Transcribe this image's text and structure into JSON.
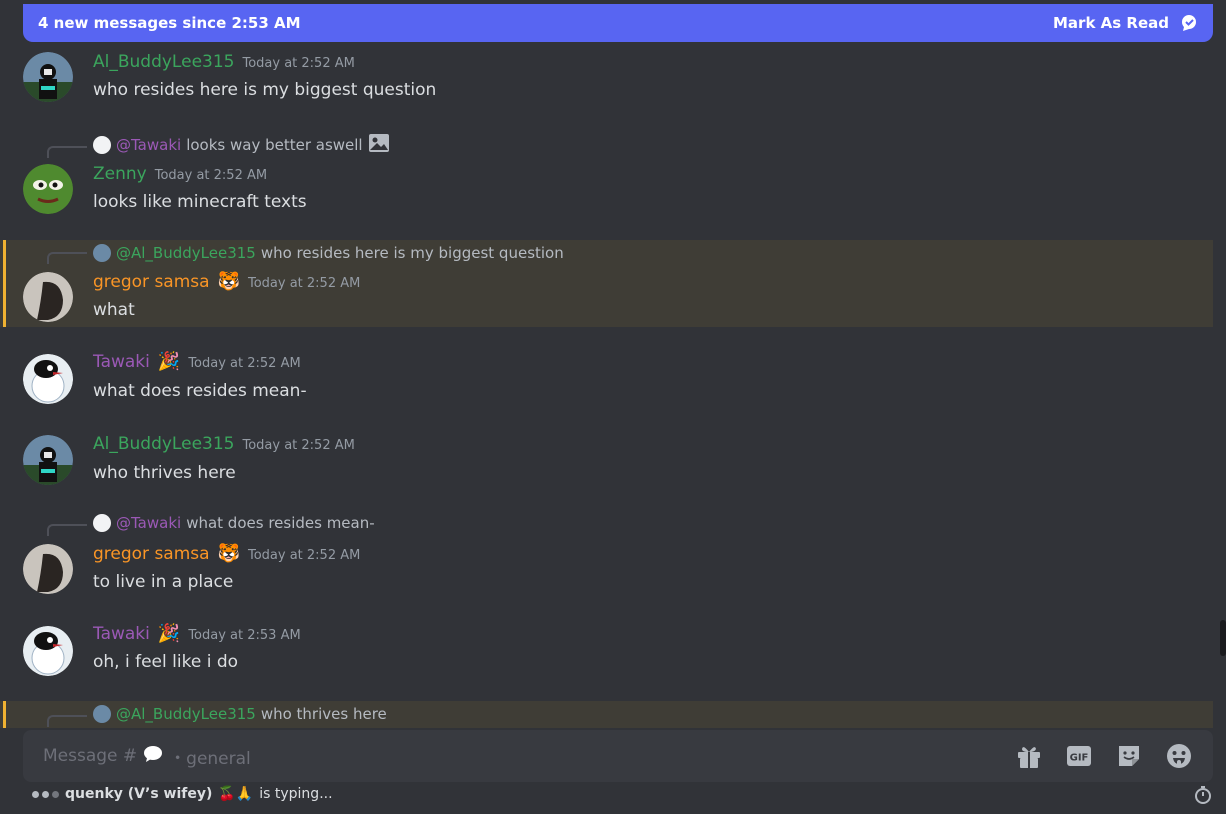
{
  "new_messages_bar": {
    "text": "4 new messages since 2:53 AM",
    "mark_as_read": "Mark As Read"
  },
  "messages": [
    {
      "author": "Al_BuddyLee315",
      "time": "Today at 2:52 AM",
      "text": "who resides here is my biggest question"
    },
    {
      "reply_to": "@Tawaki",
      "reply_text": "looks way better aswell",
      "author": "Zenny",
      "time": "Today at 2:52 AM",
      "text": "looks like minecraft texts"
    },
    {
      "reply_to": "@Al_BuddyLee315",
      "reply_text": "who resides here is my biggest question",
      "author": "gregor samsa",
      "time": "Today at 2:52 AM",
      "text": "what"
    },
    {
      "author": "Tawaki",
      "time": "Today at 2:52 AM",
      "text": "what does resides mean-"
    },
    {
      "author": "Al_BuddyLee315",
      "time": "Today at 2:52 AM",
      "text": "who thrives here"
    },
    {
      "reply_to": "@Tawaki",
      "reply_text": "what does resides mean-",
      "author": "gregor samsa",
      "time": "Today at 2:52 AM",
      "text": "to live in a place"
    },
    {
      "author": "Tawaki",
      "time": "Today at 2:53 AM",
      "text": "oh, i feel like i do"
    },
    {
      "reply_to": "@Al_BuddyLee315",
      "reply_text": "who thrives here"
    }
  ],
  "composer": {
    "placeholder_prefix": "Message #",
    "placeholder_channel": "・general"
  },
  "typing": {
    "user": "quenky (V’s wifey)",
    "emoji": "🍒🙏",
    "suffix": "is typing..."
  },
  "colors": {
    "background": "#313338",
    "accent": "#5865f2",
    "mention_highlight": "#3f3d36",
    "mention_bar": "#f0b232"
  }
}
